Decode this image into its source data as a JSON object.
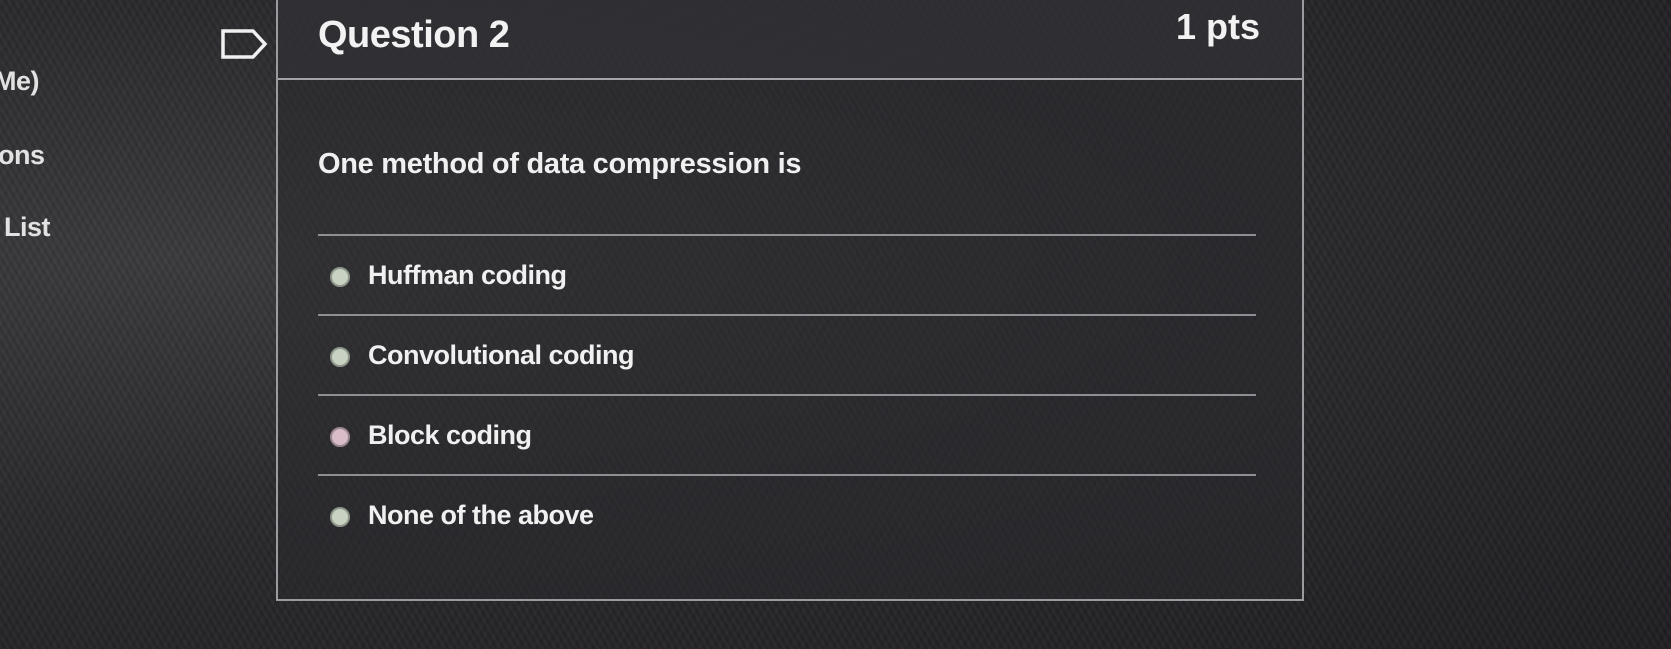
{
  "sidebar": {
    "items": [
      {
        "label": "Me)"
      },
      {
        "label": "ons"
      },
      {
        "label": "List"
      }
    ]
  },
  "question": {
    "title": "Question 2",
    "points": "1 pts",
    "text": "One method of data compression is",
    "answers": [
      {
        "label": "Huffman coding"
      },
      {
        "label": "Convolutional coding"
      },
      {
        "label": "Block coding"
      },
      {
        "label": "None of the above"
      }
    ]
  },
  "colors": {
    "background": "#2a292c",
    "text": "#ececec",
    "border": "#9b9b9f",
    "radio_fill": "#c9d1c3",
    "radio_fill_hover": "#d8bcc8"
  }
}
